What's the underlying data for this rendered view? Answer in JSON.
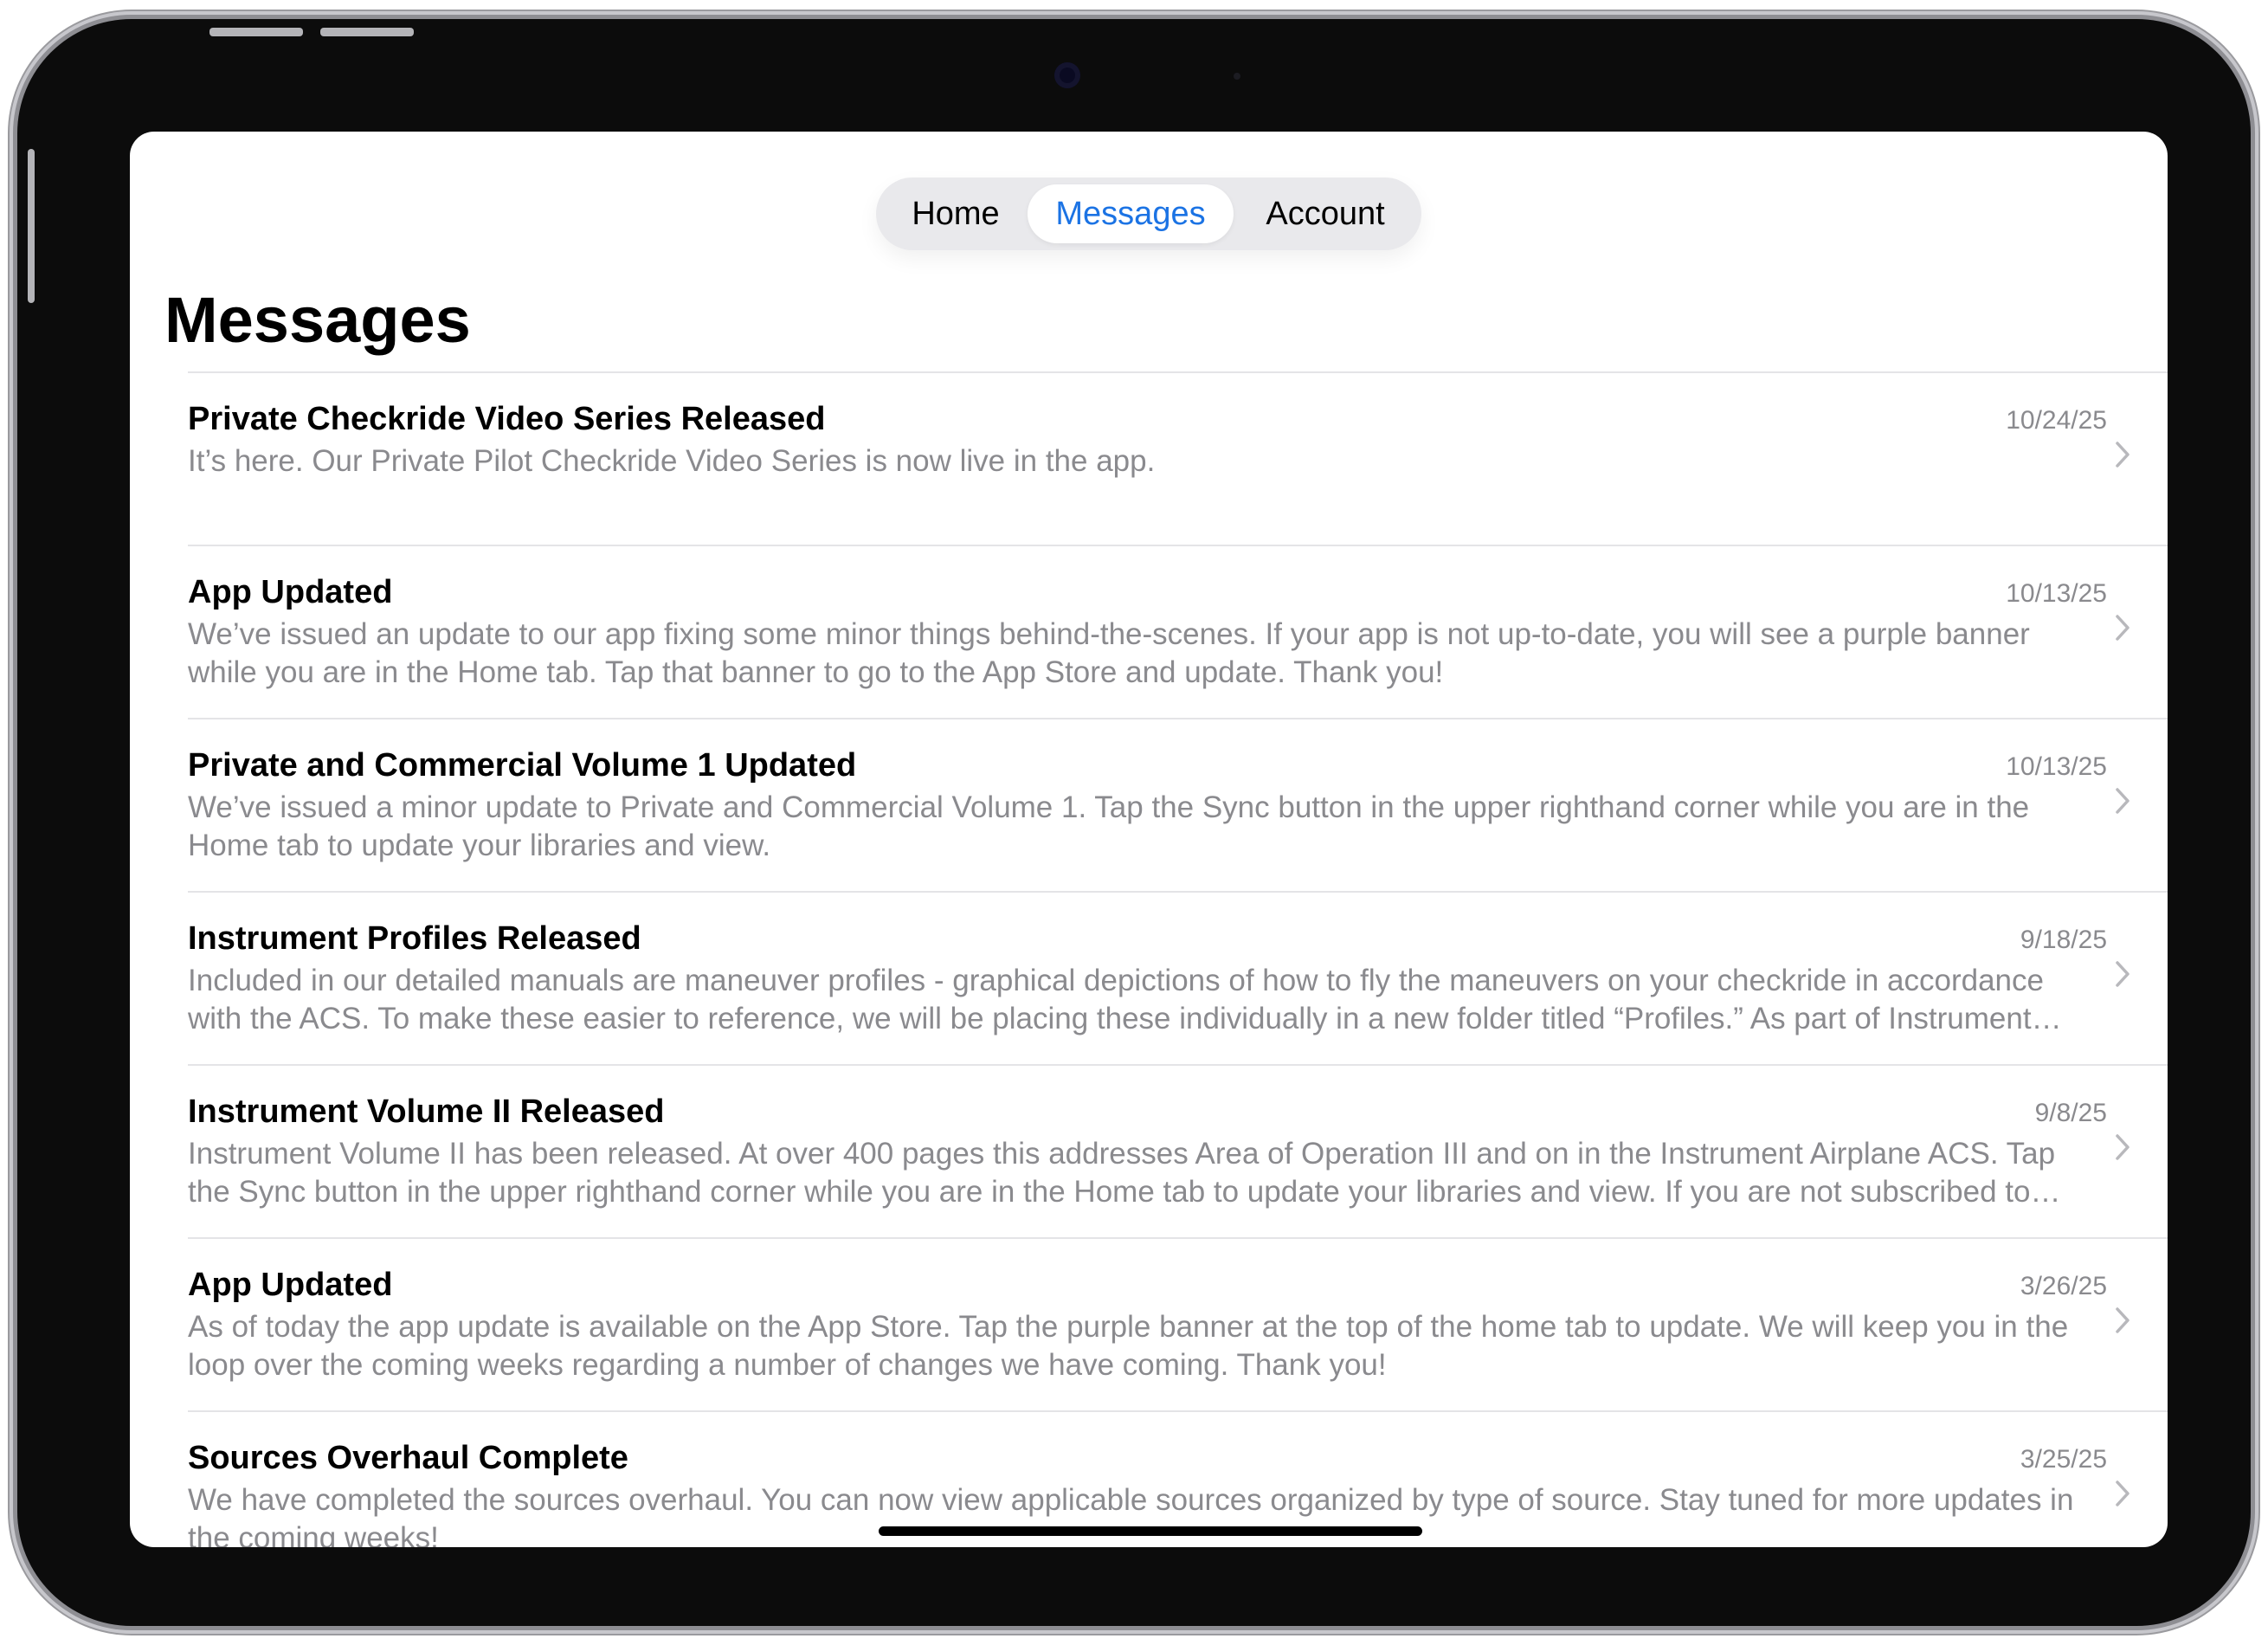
{
  "tabs": [
    {
      "label": "Home"
    },
    {
      "label": "Messages"
    },
    {
      "label": "Account"
    }
  ],
  "selected_tab": "Messages",
  "page_title": "Messages",
  "messages": [
    {
      "title": "Private Checkride Video Series Released",
      "date": "10/24/25",
      "body": "It’s here. Our Private Pilot Checkride Video Series is now live in the app."
    },
    {
      "title": "App Updated",
      "date": "10/13/25",
      "body": "We’ve issued an update to our app fixing some minor things behind-the-scenes. If your app is not up-to-date, you will see a purple banner while you are in the Home tab. Tap that banner to go to the App Store and update. Thank you!"
    },
    {
      "title": "Private and Commercial Volume 1 Updated",
      "date": "10/13/25",
      "body": "We’ve issued a minor update to Private and Commercial Volume 1. Tap the Sync button in the upper righthand corner while you are in the Home tab to update your libraries and view."
    },
    {
      "title": "Instrument Profiles Released",
      "date": "9/18/25",
      "body": "Included in our detailed manuals are maneuver profiles - graphical depictions of how to fly the maneuvers on your checkride in accordance with the ACS. To make these easier to reference, we will be placing these individually in a new folder titled “Profiles.” As part of Instrument Volume II,..."
    },
    {
      "title": "Instrument Volume II Released",
      "date": "9/8/25",
      "body": "Instrument Volume II has been released. At over 400 pages this addresses Area of Operation III and on in the Instrument Airplane ACS. Tap the Sync button in the upper righthand corner while you are in the Home tab to update your libraries and view. If you are not subscribed to anything,..."
    },
    {
      "title": "App Updated",
      "date": "3/26/25",
      "body": "As of today the app update is available on the App Store. Tap the purple banner at the top of the home tab to update. We will keep you in the loop over the coming weeks regarding a number of changes we have coming. Thank you!"
    },
    {
      "title": "Sources Overhaul Complete",
      "date": "3/25/25",
      "body": "We have completed the sources overhaul. You can now view applicable sources organized by type of source. Stay tuned for more updates in the coming weeks!"
    }
  ],
  "colors": {
    "accent": "#1b73e4",
    "secondary_text": "#8a8a8e",
    "separator": "#e4e4e7",
    "tabbar_bg": "#e9e9ec"
  }
}
